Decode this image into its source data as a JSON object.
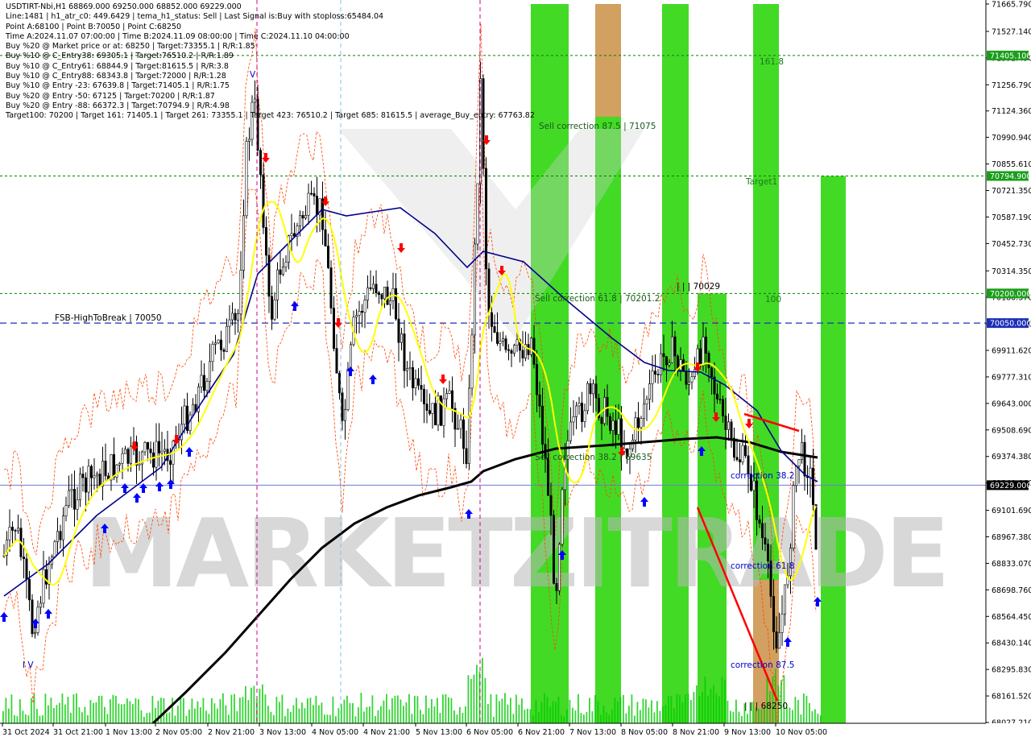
{
  "header": {
    "lines": [
      "USDTIRT-Nbi,H1  68869.000 69250.000 68852.000 69229.000",
      "Line:1481  |  h1_atr_c0: 449.6429  |  tema_h1_status: Sell  |  Last Signal is:Buy with stoploss:65484.04",
      "Point A:68100  |  Point B:70050  |  Point C:68250",
      "Time A:2024.11.07 07:00:00  |  Time B:2024.11.09 08:00:00  |  Time C:2024.11.10 04:00:00",
      "Buy %20 @ Market price or at: 68250  |  Target:73355.1  |  R/R:1.85",
      "Buy %10 @ C_Entry38: 69305.1  |  Target:76510.2  |  R/R:1.89",
      "Buy %10 @ C_Entry61: 68844.9  |  Target:81615.5  |  R/R:3.8",
      "Buy %10 @ C_Entry88: 68343.8  |  Target:72000  |  R/R:1.28",
      "Buy %10 @ Entry -23: 67639.8  |  Target:71405.1  |  R/R:1.75",
      "Buy %20 @ Entry -50: 67125  |  Target:70200  |  R/R:1.87",
      "Buy %20 @ Entry -88: 66372.3  |  Target:70794.9  |  R/R:4.98",
      "Target100: 70200  |  Target 161: 71405.1  |  Target 261: 73355.1  |  Target 423: 76510.2  |  Target 685: 81615.5  |  average_Buy_entry: 67763.82"
    ]
  },
  "price_axis": {
    "ticks": [
      "71665.790",
      "71527.140",
      "71392.490",
      "71256.790",
      "71124.360",
      "70990.940",
      "70855.610",
      "70721.350",
      "70587.190",
      "70452.730",
      "70314.350",
      "70180.370",
      "70046.000",
      "69911.620",
      "69777.310",
      "69643.000",
      "69508.690",
      "69374.380",
      "69240.060",
      "69101.690",
      "68967.380",
      "68833.070",
      "68698.760",
      "68564.450",
      "68430.140",
      "68295.830",
      "68161.520",
      "68027.210"
    ],
    "highlights": [
      {
        "label": "71405.100",
        "color": "#1a9e1a"
      },
      {
        "label": "70794.900",
        "color": "#1a9e1a"
      },
      {
        "label": "70200.000",
        "color": "#1a9e1a"
      },
      {
        "label": "70050.000",
        "color": "#1c2fb8"
      },
      {
        "label": "69229.000",
        "color": "#000000"
      }
    ]
  },
  "time_axis": {
    "ticks": [
      "31 Oct 2024",
      "31 Oct 21:00",
      "1 Nov 13:00",
      "2 Nov 05:00",
      "2 Nov 21:00",
      "3 Nov 13:00",
      "4 Nov 05:00",
      "4 Nov 21:00",
      "5 Nov 13:00",
      "6 Nov 05:00",
      "6 Nov 21:00",
      "7 Nov 13:00",
      "8 Nov 05:00",
      "8 Nov 21:00",
      "9 Nov 13:00",
      "10 Nov 05:00"
    ]
  },
  "annotations": {
    "fsb": "FSB-HighToBreak | 70050",
    "level_161": "161.8",
    "target1": "Target1",
    "level_100": "100",
    "sell_875": "Sell correction 87.5 | 71075",
    "sell_618": "Sell correction 61.8 | 70201.2",
    "sell_382": "Sell correction 38.2 | 69635",
    "high_b": "| | | 70029",
    "corr_382": "correction 38.2",
    "corr_618": "correction 61.8",
    "corr_875": "correction 87.5",
    "low_c": "| | | 68250",
    "wave_v": "V",
    "wave_iv": "I V",
    "watermark": "MARKETZITRADE"
  },
  "colors": {
    "background": "#ffffff",
    "green_band": "#22d400",
    "orange_band": "#d2a060",
    "ema_slow": "#000000",
    "ema_mid": "#00008b",
    "ema_fast": "#ffff00",
    "envelope": "#ff4500",
    "buy_arrow": "#0000ff",
    "sell_arrow": "#ff0000",
    "fsb_line": "#1c2fb8",
    "target_line": "#008000",
    "volume": "#00cc00"
  }
}
